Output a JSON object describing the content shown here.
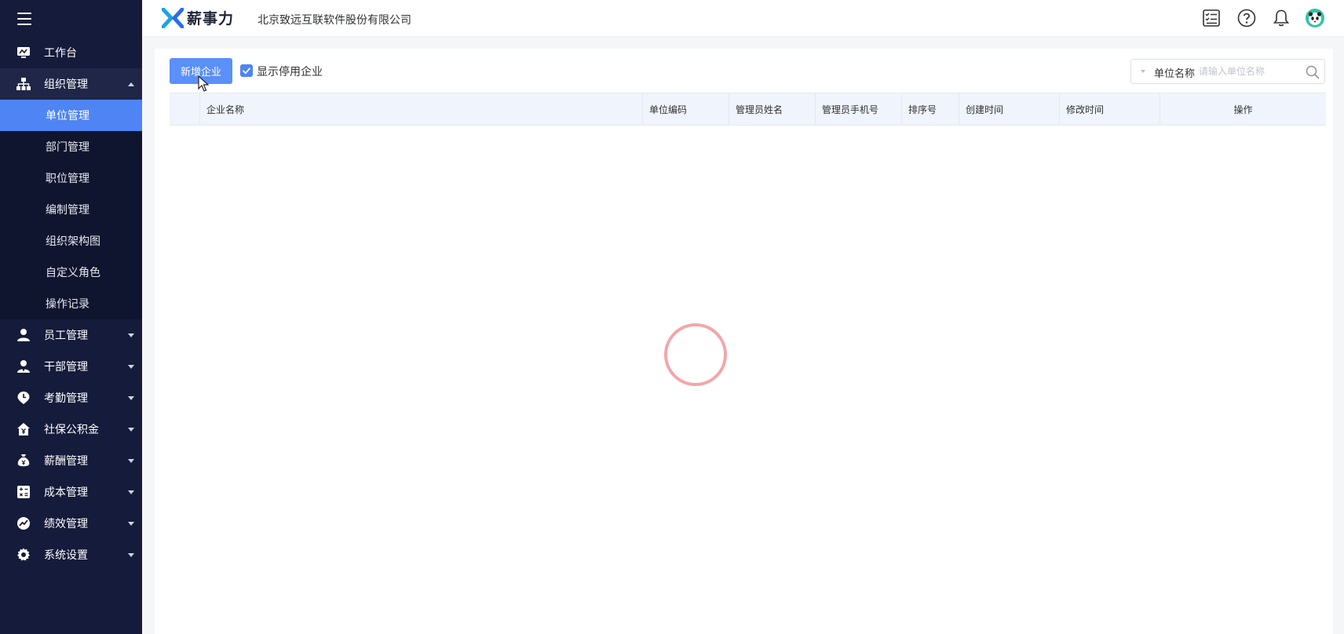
{
  "sidebar": {
    "items": [
      {
        "label": "工作台"
      },
      {
        "label": "组织管理"
      },
      {
        "label": "员工管理"
      },
      {
        "label": "干部管理"
      },
      {
        "label": "考勤管理"
      },
      {
        "label": "社保公积金"
      },
      {
        "label": "薪酬管理"
      },
      {
        "label": "成本管理"
      },
      {
        "label": "绩效管理"
      },
      {
        "label": "系统设置"
      }
    ],
    "sub_items": [
      {
        "label": "单位管理",
        "active": true
      },
      {
        "label": "部门管理"
      },
      {
        "label": "职位管理"
      },
      {
        "label": "编制管理"
      },
      {
        "label": "组织架构图"
      },
      {
        "label": "自定义角色"
      },
      {
        "label": "操作记录"
      }
    ]
  },
  "header": {
    "logo_text": "薪事力",
    "company": "北京致远互联软件股份有限公司",
    "icons": [
      "task-list-icon",
      "help-icon",
      "bell-icon",
      "avatar"
    ]
  },
  "toolbar": {
    "add_button": "新增企业",
    "show_disabled_label": "显示停用企业",
    "show_disabled_checked": true
  },
  "search": {
    "field_label": "单位名称",
    "placeholder": "请输入单位名称"
  },
  "table": {
    "columns": [
      "企业名称",
      "单位编码",
      "管理员姓名",
      "管理员手机号",
      "排序号",
      "创建时间",
      "修改时间",
      "操作"
    ],
    "rows": []
  },
  "colors": {
    "sidebar_bg": "#151b3a",
    "accent": "#4e84f4",
    "spinner": "#f2a6aa"
  }
}
